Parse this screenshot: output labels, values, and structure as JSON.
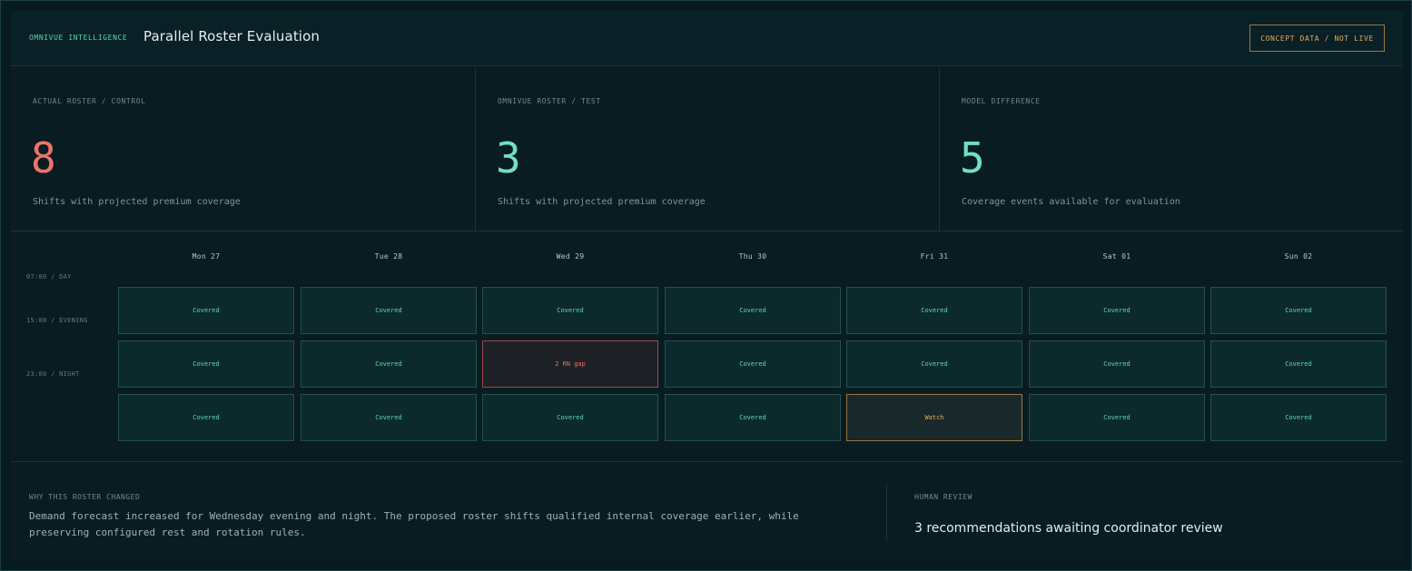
{
  "header": {
    "brand": "OMNIVUE INTELLIGENCE",
    "title": "Parallel Roster Evaluation",
    "badge": "CONCEPT DATA / NOT LIVE"
  },
  "colors": {
    "accent": "#57d3b2",
    "danger": "#ef6e62",
    "warning": "#e7a85a",
    "background": "#081c22"
  },
  "stats": [
    {
      "label": "ACTUAL ROSTER / CONTROL",
      "value": "8",
      "description": "Shifts with projected premium coverage",
      "color": "#ef7468"
    },
    {
      "label": "OMNIVUE ROSTER / TEST",
      "value": "3",
      "description": "Shifts with projected premium coverage",
      "color": "#6fe0c2"
    },
    {
      "label": "MODEL DIFFERENCE",
      "value": "5",
      "description": "Coverage events available for evaluation",
      "color": "#6fe0c2"
    }
  ],
  "grid": {
    "time_labels": [
      "07:00 / DAY",
      "15:00 / EVENING",
      "23:00 / NIGHT"
    ],
    "days": [
      "Mon 27",
      "Tue 28",
      "Wed 29",
      "Thu 30",
      "Fri 31",
      "Sat 01",
      "Sun 02"
    ],
    "rows": [
      [
        {
          "text": "Covered",
          "status": "covered"
        },
        {
          "text": "Covered",
          "status": "covered"
        },
        {
          "text": "Covered",
          "status": "covered"
        },
        {
          "text": "Covered",
          "status": "covered"
        },
        {
          "text": "Covered",
          "status": "covered"
        },
        {
          "text": "Covered",
          "status": "covered"
        },
        {
          "text": "Covered",
          "status": "covered"
        }
      ],
      [
        {
          "text": "Covered",
          "status": "covered"
        },
        {
          "text": "Covered",
          "status": "covered"
        },
        {
          "text": "2 RN gap",
          "status": "gap"
        },
        {
          "text": "Covered",
          "status": "covered"
        },
        {
          "text": "Covered",
          "status": "covered"
        },
        {
          "text": "Covered",
          "status": "covered"
        },
        {
          "text": "Covered",
          "status": "covered"
        }
      ],
      [
        {
          "text": "Covered",
          "status": "covered"
        },
        {
          "text": "Covered",
          "status": "covered"
        },
        {
          "text": "Covered",
          "status": "covered"
        },
        {
          "text": "Covered",
          "status": "covered"
        },
        {
          "text": "Watch",
          "status": "watch"
        },
        {
          "text": "Covered",
          "status": "covered"
        },
        {
          "text": "Covered",
          "status": "covered"
        }
      ]
    ]
  },
  "footer": {
    "why_label": "WHY THIS ROSTER CHANGED",
    "why_text": "Demand forecast increased for Wednesday evening and night. The proposed roster shifts qualified internal coverage earlier, while preserving configured rest and rotation rules.",
    "review_label": "HUMAN REVIEW",
    "review_text": "3 recommendations awaiting coordinator review"
  }
}
